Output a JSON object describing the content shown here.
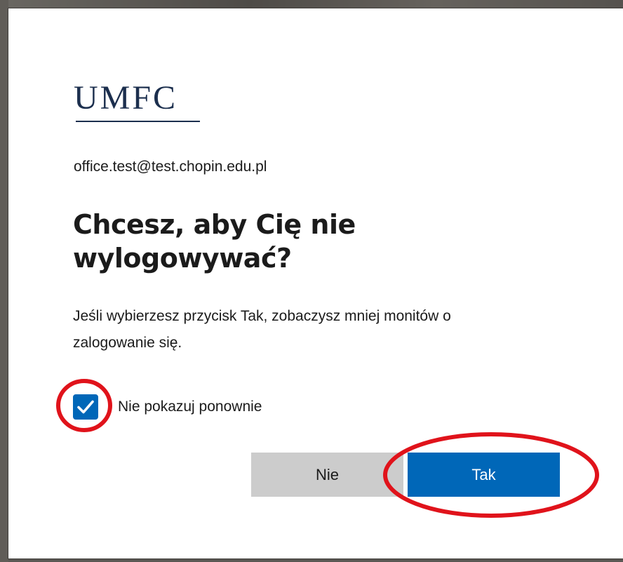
{
  "brand": {
    "logo_text": "UMFC"
  },
  "account": {
    "email": "office.test@test.chopin.edu.pl"
  },
  "prompt": {
    "title": "Chcesz, aby Cię nie wylogowywać?",
    "description": "Jeśli wybierzesz przycisk Tak, zobaczysz mniej monitów o zalogowanie się."
  },
  "checkbox": {
    "label": "Nie pokazuj ponownie",
    "checked": true
  },
  "buttons": {
    "no_label": "Nie",
    "yes_label": "Tak"
  },
  "colors": {
    "primary": "#0067b8",
    "secondary_button": "#cccccc",
    "logo": "#1c2f4e",
    "annotation": "#e0131b"
  }
}
